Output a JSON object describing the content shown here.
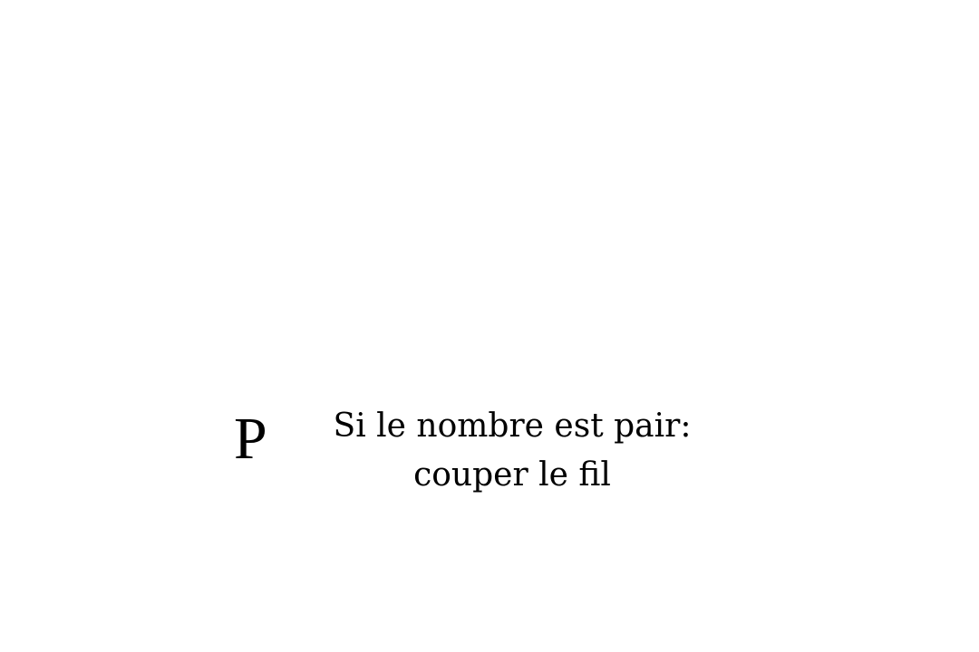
{
  "rule": {
    "letter": "P",
    "lines": [
      "Si le nombre est pair:",
      "couper le fil"
    ]
  }
}
